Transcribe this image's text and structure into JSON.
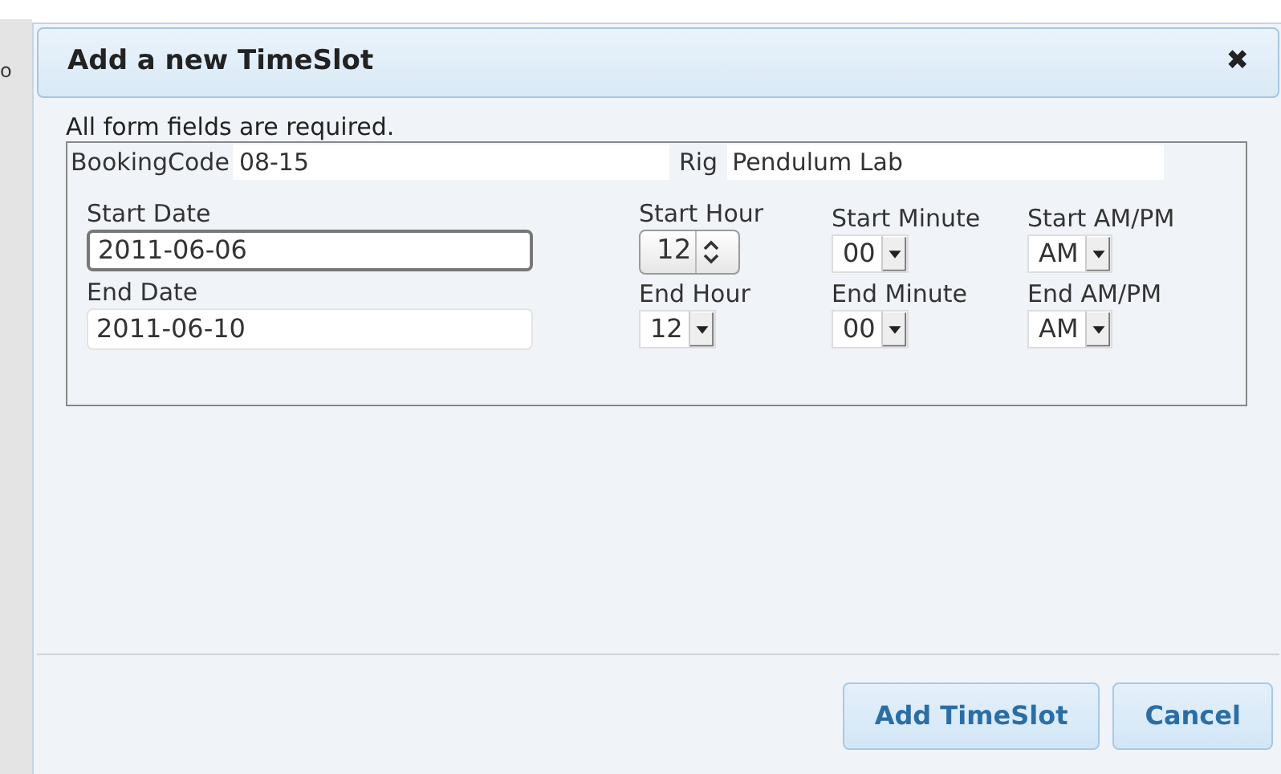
{
  "background_text": "o",
  "dialog": {
    "title": "Add a new TimeSlot",
    "close": "✖",
    "note": "All form fields are required.",
    "booking": {
      "label": "BookingCode",
      "value": "08-15"
    },
    "rig": {
      "label": "Rig",
      "value": "Pendulum Lab"
    },
    "dates": [
      {
        "label": "Start Date",
        "value": "2011-06-06",
        "focused": true
      },
      {
        "label": "End Date",
        "value": "2011-06-10",
        "focused": false
      }
    ],
    "time_rows": [
      [
        {
          "label": "Start Hour",
          "value": "12",
          "kind": "spinner"
        },
        {
          "label": "Start Minute",
          "value": "00",
          "kind": "dropdown"
        },
        {
          "label": "Start AM/PM",
          "value": "AM",
          "kind": "dropdown"
        }
      ],
      [
        {
          "label": "End Hour",
          "value": "12",
          "kind": "dropdown"
        },
        {
          "label": "End Minute",
          "value": "00",
          "kind": "dropdown"
        },
        {
          "label": "End AM/PM",
          "value": "AM",
          "kind": "dropdown"
        }
      ]
    ],
    "buttons": [
      "Add TimeSlot",
      "Cancel"
    ]
  }
}
